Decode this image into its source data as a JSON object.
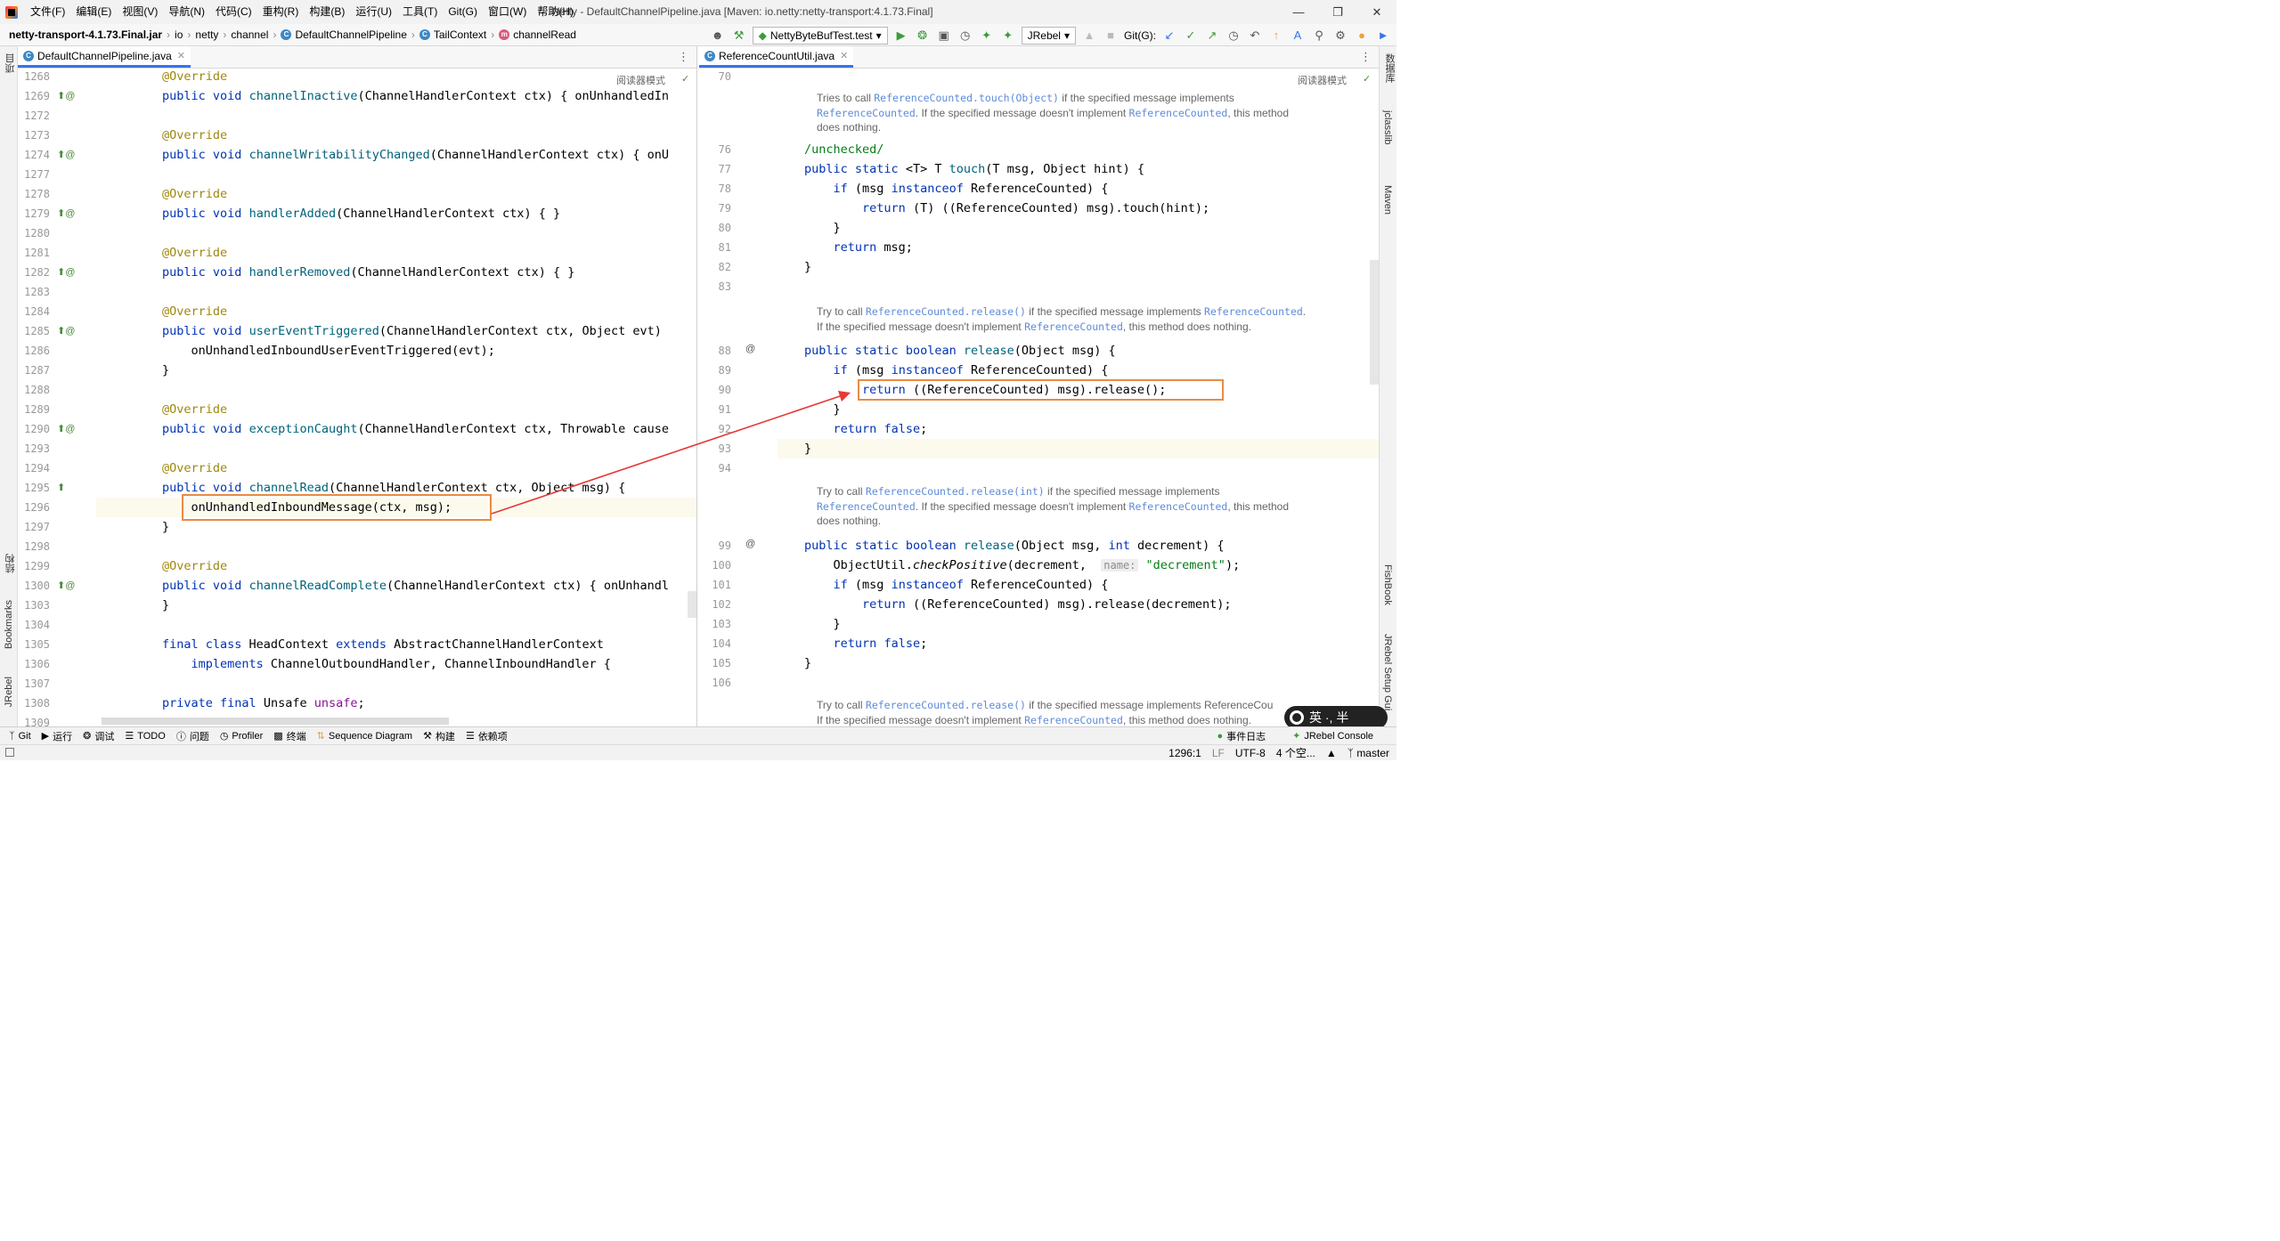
{
  "titlebar": {
    "menu": [
      "文件(F)",
      "编辑(E)",
      "视图(V)",
      "导航(N)",
      "代码(C)",
      "重构(R)",
      "构建(B)",
      "运行(U)",
      "工具(T)",
      "Git(G)",
      "窗口(W)",
      "帮助(H)"
    ],
    "title": "Netty - DefaultChannelPipeline.java [Maven: io.netty:netty-transport:4.1.73.Final]"
  },
  "navbar": {
    "crumbs": [
      "netty-transport-4.1.73.Final.jar",
      "io",
      "netty",
      "channel",
      "DefaultChannelPipeline",
      "TailContext",
      "channelRead"
    ],
    "run_config": "NettyByteBufTest.test",
    "jrebel": "JRebel",
    "git_label": "Git(G):"
  },
  "left_editor": {
    "tab": "DefaultChannelPipeline.java",
    "reader_mode": "阅读器模式",
    "lines": [
      {
        "n": "1268",
        "code": "@Override"
      },
      {
        "n": "1269",
        "code": "public void channelInactive(ChannelHandlerContext ctx) { onUnhandledIn"
      },
      {
        "n": "1272",
        "code": ""
      },
      {
        "n": "1273",
        "code": "@Override"
      },
      {
        "n": "1274",
        "code": "public void channelWritabilityChanged(ChannelHandlerContext ctx) { onU"
      },
      {
        "n": "1277",
        "code": ""
      },
      {
        "n": "1278",
        "code": "@Override"
      },
      {
        "n": "1279",
        "code": "public void handlerAdded(ChannelHandlerContext ctx) { }"
      },
      {
        "n": "1280",
        "code": ""
      },
      {
        "n": "1281",
        "code": "@Override"
      },
      {
        "n": "1282",
        "code": "public void handlerRemoved(ChannelHandlerContext ctx) { }"
      },
      {
        "n": "1283",
        "code": ""
      },
      {
        "n": "1284",
        "code": "@Override"
      },
      {
        "n": "1285",
        "code": "public void userEventTriggered(ChannelHandlerContext ctx, Object evt)"
      },
      {
        "n": "1286",
        "code": "    onUnhandledInboundUserEventTriggered(evt);"
      },
      {
        "n": "1287",
        "code": "}"
      },
      {
        "n": "1288",
        "code": ""
      },
      {
        "n": "1289",
        "code": "@Override"
      },
      {
        "n": "1290",
        "code": "public void exceptionCaught(ChannelHandlerContext ctx, Throwable cause"
      },
      {
        "n": "1293",
        "code": ""
      },
      {
        "n": "1294",
        "code": "@Override"
      },
      {
        "n": "1295",
        "code": "public void channelRead(ChannelHandlerContext ctx, Object msg) {"
      },
      {
        "n": "1296",
        "code": "    onUnhandledInboundMessage(ctx, msg);"
      },
      {
        "n": "1297",
        "code": "}"
      },
      {
        "n": "1298",
        "code": ""
      },
      {
        "n": "1299",
        "code": "@Override"
      },
      {
        "n": "1300",
        "code": "public void channelReadComplete(ChannelHandlerContext ctx) { onUnhandl"
      },
      {
        "n": "1303",
        "code": "}"
      },
      {
        "n": "1304",
        "code": ""
      },
      {
        "n": "1305",
        "code": "final class HeadContext extends AbstractChannelHandlerContext"
      },
      {
        "n": "1306",
        "code": "    implements ChannelOutboundHandler, ChannelInboundHandler {"
      },
      {
        "n": "1307",
        "code": ""
      },
      {
        "n": "1308",
        "code": "private final Unsafe unsafe;"
      },
      {
        "n": "1309",
        "code": ""
      }
    ]
  },
  "right_editor": {
    "tab": "ReferenceCountUtil.java",
    "reader_mode": "阅读器模式",
    "docs": [
      [
        "Tries to call ReferenceCounted.touch(Object) if the specified message implements",
        "ReferenceCounted. If the specified message doesn't implement ReferenceCounted, this method",
        "does nothing."
      ],
      [
        "Try to call ReferenceCounted.release() if the specified message implements ReferenceCounted.",
        "If the specified message doesn't implement ReferenceCounted, this method does nothing."
      ],
      [
        "Try to call ReferenceCounted.release(int) if the specified message implements",
        "ReferenceCounted. If the specified message doesn't implement ReferenceCounted, this method",
        "does nothing."
      ],
      [
        "Try to call ReferenceCounted.release() if the specified message implements ReferenceCou",
        "If the specified message doesn't implement ReferenceCounted, this method does nothing."
      ]
    ],
    "lines": [
      {
        "n": "70",
        "code": ""
      },
      {
        "n": "76",
        "code": "/unchecked/"
      },
      {
        "n": "77",
        "code": "public static <T> T touch(T msg, Object hint) {"
      },
      {
        "n": "78",
        "code": "    if (msg instanceof ReferenceCounted) {"
      },
      {
        "n": "79",
        "code": "        return (T) ((ReferenceCounted) msg).touch(hint);"
      },
      {
        "n": "80",
        "code": "    }"
      },
      {
        "n": "81",
        "code": "    return msg;"
      },
      {
        "n": "82",
        "code": "}"
      },
      {
        "n": "83",
        "code": ""
      },
      {
        "n": "88",
        "code": "public static boolean release(Object msg) {"
      },
      {
        "n": "89",
        "code": "    if (msg instanceof ReferenceCounted) {"
      },
      {
        "n": "90",
        "code": "        return ((ReferenceCounted) msg).release();"
      },
      {
        "n": "91",
        "code": "    }"
      },
      {
        "n": "92",
        "code": "    return false;"
      },
      {
        "n": "93",
        "code": "}"
      },
      {
        "n": "94",
        "code": ""
      },
      {
        "n": "99",
        "code": "public static boolean release(Object msg, int decrement) {"
      },
      {
        "n": "100",
        "code": "    ObjectUtil.checkPositive(decrement,  name: \"decrement\");"
      },
      {
        "n": "101",
        "code": "    if (msg instanceof ReferenceCounted) {"
      },
      {
        "n": "102",
        "code": "        return ((ReferenceCounted) msg).release(decrement);"
      },
      {
        "n": "103",
        "code": "    }"
      },
      {
        "n": "104",
        "code": "    return false;"
      },
      {
        "n": "105",
        "code": "}"
      },
      {
        "n": "106",
        "code": ""
      }
    ]
  },
  "side_labels": {
    "left": [
      "项目",
      "结构",
      "Bookmarks",
      "JRebel"
    ],
    "right": [
      "数据库",
      "jclasslib",
      "Maven",
      "FishBook",
      "JRebel Setup Gui"
    ]
  },
  "tool_windows": [
    "Git",
    "运行",
    "调试",
    "TODO",
    "问题",
    "Profiler",
    "终端",
    "Sequence Diagram",
    "构建",
    "依赖项"
  ],
  "tool_windows_right": [
    "事件日志",
    "JRebel Console"
  ],
  "status": {
    "position": "1296:1",
    "line_sep": "LF",
    "encoding": "UTF-8",
    "indent": "4 个空...",
    "branch": "master"
  },
  "ime": "英 ·, 半"
}
